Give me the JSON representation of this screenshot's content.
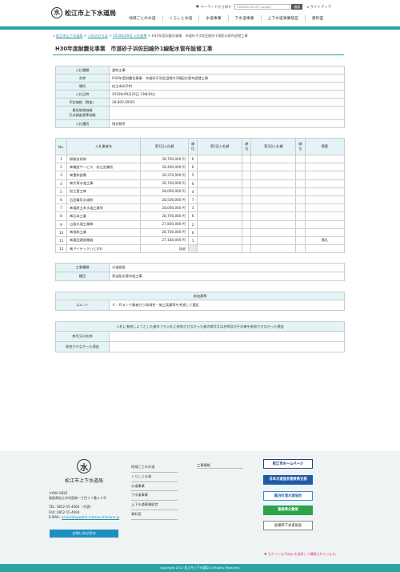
{
  "header": {
    "logo_glyph": "水",
    "title": "松江市上下水道局",
    "keyword_label": "キーワードから探す",
    "search_placeholder": "ENHANCED BY Google",
    "search_button": "検索",
    "sitemap": "サイトマップ",
    "nav": [
      "地域ごとの水道",
      "くらしと水道",
      "水道事業",
      "下水道事業",
      "上下水道事業経営",
      "資料室"
    ]
  },
  "breadcrumb": {
    "items": [
      "松江市上下水道局",
      "入札のひろば",
      "2018年09月 入札結果"
    ],
    "current": "H30年度耐震化事業　市道砂子浜佐田線外1線配水管布設替工事"
  },
  "page_title": "H30年度耐震化事業　市道砂子浜佐田線外1線配水管布設替工事",
  "info": [
    {
      "label": "入札種類",
      "value": "通知工事"
    },
    {
      "label": "名称",
      "value": "H30年度耐震化事業　市道砂子浜佐田線外1線配水管布設替工事"
    },
    {
      "label": "場所",
      "value": "松江市砂子町"
    },
    {
      "label": "入札日時",
      "value": "2018年09月20日 13時30分"
    },
    {
      "label": "予定価格（税抜）",
      "value": "28,800,000円"
    },
    {
      "label": "最低制限価格\n又は調査基準価格",
      "value": ""
    },
    {
      "label": "入札種別",
      "value": "指名競争"
    }
  ],
  "bids": {
    "headers": {
      "no": "No.",
      "name": "入札業者名",
      "bid1": "第1回入札額",
      "rank": "順位",
      "bid2": "第2回入札額",
      "bid3": "第3回入札額",
      "note": "摘要"
    },
    "rows": [
      {
        "no": "1",
        "name": "柳楽技研㈲",
        "bid1": "28,700,000 円",
        "rank": "6",
        "note": ""
      },
      {
        "no": "2",
        "name": "㈱電設サービス　松江営業所",
        "bid1": "28,400,000 円",
        "rank": "6",
        "note": ""
      },
      {
        "no": "3",
        "name": "㈱豊和設備",
        "bid1": "28,370,000 円",
        "rank": "5",
        "note": ""
      },
      {
        "no": "4",
        "name": "㈱大塚水道工事",
        "bid1": "28,700,000 円",
        "rank": "6",
        "note": ""
      },
      {
        "no": "5",
        "name": "松江管工㈱",
        "bid1": "28,090,000 円",
        "rank": "4",
        "note": ""
      },
      {
        "no": "6",
        "name": "石田電気水道㈲",
        "bid1": "28,500,000 円",
        "rank": "7",
        "note": ""
      },
      {
        "no": "7",
        "name": "㈱福原土木水道工業所",
        "bid1": "28,000,000 円",
        "rank": "3",
        "note": ""
      },
      {
        "no": "8",
        "name": "㈱石本工業",
        "bid1": "28,700,000 円",
        "rank": "6",
        "note": ""
      },
      {
        "no": "9",
        "name": "山陰水道工業㈱",
        "bid1": "27,800,000 円",
        "rank": "2",
        "note": ""
      },
      {
        "no": "10",
        "name": "㈱協和工業",
        "bid1": "28,700,000 円",
        "rank": "6",
        "note": ""
      },
      {
        "no": "11",
        "name": "㈱喜田建設機器",
        "bid1": "27,180,000 円",
        "rank": "1",
        "note": "落札"
      },
      {
        "no": "12",
        "name": "㈱アイテックいとがわ",
        "bid1": "辞退",
        "rank": "",
        "note": ""
      }
    ]
  },
  "kind": [
    {
      "label": "工事種類",
      "value": "水道施設"
    },
    {
      "label": "種目",
      "value": "導送配水管布設工事"
    }
  ],
  "criteria": {
    "title": "参加基準",
    "label": "コメント",
    "value": "Ａ・Ｂランク業者から地域性・施工実績等を考慮して選定"
  },
  "exclusion": {
    "title": "入札に参加しようとした者のうち入札に参加させなかった者の商号又は名称及びその者を参加させなかった理由",
    "rows": [
      {
        "label": "商号又は名称",
        "value": ""
      },
      {
        "label": "参加させなかった理由",
        "value": ""
      }
    ]
  },
  "footer": {
    "org": "松江市上下水道局",
    "address": [
      "〒690-0826",
      "島根県松江市学園南一丁目１７番２４号"
    ],
    "tel": "TEL: 0852-55-4666 （代表）",
    "fax": "FAX: 0852-55-4690",
    "email_label": "E-MAIL:",
    "email": "sessuido@water.matsue.shimane.jp",
    "contact_button": "お問い合せ窓口",
    "nav": [
      "地域ごとの水道",
      "くらしと水道",
      "水道事業",
      "下水道事業",
      "上下水道事業経営",
      "資料室"
    ],
    "nav2": [
      "工事情報"
    ],
    "banners": [
      "松江市ホームページ",
      "日本水道協会島根県支部",
      "鍛冶町道水道協会",
      "島根県企業局",
      "島根県下水道協会"
    ],
    "notice": "当サイトは Ruby を使用して構築されています。",
    "copyright": "Copyright 2012 松江市上下水道局 All Rights Reserved."
  }
}
